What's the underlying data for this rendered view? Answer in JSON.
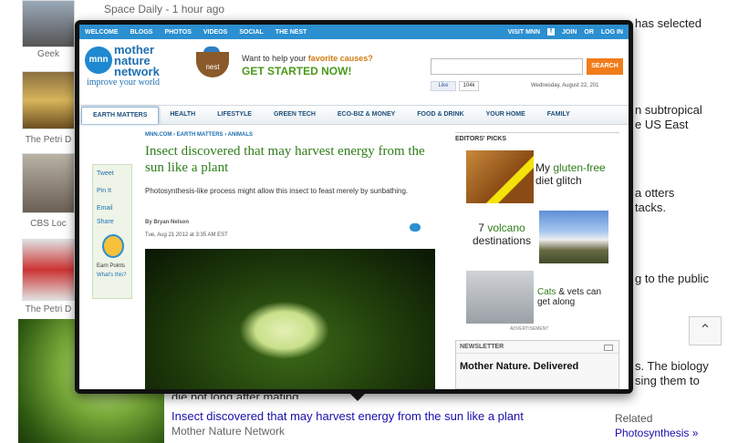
{
  "background": {
    "top_line_source": "Space Daily",
    "top_line_time": "1 hour ago",
    "line1_fragment": "has selected",
    "captions": [
      "Geek",
      "The Petri D",
      "CBS Loc",
      "The Petri D"
    ],
    "fragments": [
      "n subtropical",
      "e US East",
      "a otters",
      "tacks.",
      "g to the public",
      "s. The biology",
      "sing them to"
    ],
    "obscured_line": "die not long after mating.",
    "result_link": "Insect discovered that may harvest energy from the sun like a plant",
    "result_source": "Mother Nature Network",
    "related_label": "Related",
    "related_link": "Photosynthesis »",
    "scroll_top_icon": "double-chevron-up-icon"
  },
  "site": {
    "topbar_links": [
      "WELCOME",
      "BLOGS",
      "PHOTOS",
      "VIDEOS",
      "SOCIAL",
      "THE NEST"
    ],
    "topbar_right": [
      "VISIT MNN",
      "JOIN",
      "OR",
      "LOG IN"
    ],
    "logo_mark": "mnn",
    "logo_lines": [
      "mother",
      "nature",
      "network"
    ],
    "tagline": "improve your world",
    "nest_label": "nest",
    "help_prefix": "Want to help your",
    "help_emphasis": "favorite causes?",
    "cta": "GET STARTED NOW!",
    "search_placeholder": "",
    "search_button": "SEARCH",
    "like_label": "Like",
    "like_count": "104k",
    "date": "Wednesday, August 22, 201",
    "nav": [
      "EARTH MATTERS",
      "HEALTH",
      "LIFESTYLE",
      "GREEN TECH",
      "ECO-BIZ & MONEY",
      "FOOD & DRINK",
      "YOUR HOME",
      "FAMILY"
    ],
    "breadcrumb": "MNN.COM › EARTH MATTERS › ANIMALS",
    "headline": "Insect discovered that may harvest energy from the sun like a plant",
    "dek": "Photosynthesis-like process might allow this insect to feast merely by sunbathing.",
    "byline": "By Bryan Nelson",
    "pubdate": "Tue, Aug 21 2012 at 3:35 AM EST",
    "share": [
      "Tweet",
      "Pin It",
      "Email",
      "Share",
      "Earn Points",
      "What's this?"
    ],
    "sidebar_heading": "EDITORS' PICKS",
    "pick1_prefix": "My",
    "pick1_emphasis": "gluten-free",
    "pick1_suffix": "diet glitch",
    "pick2_prefix": "7",
    "pick2_emphasis": "volcano",
    "pick2_suffix": "destinations",
    "pick3_emphasis": "Cats",
    "pick3_suffix": "& vets can get along",
    "advertisement": "ADVERTISEMENT",
    "newsletter_title": "NEWSLETTER",
    "newsletter_sub": "Mother Nature. Delivered"
  }
}
